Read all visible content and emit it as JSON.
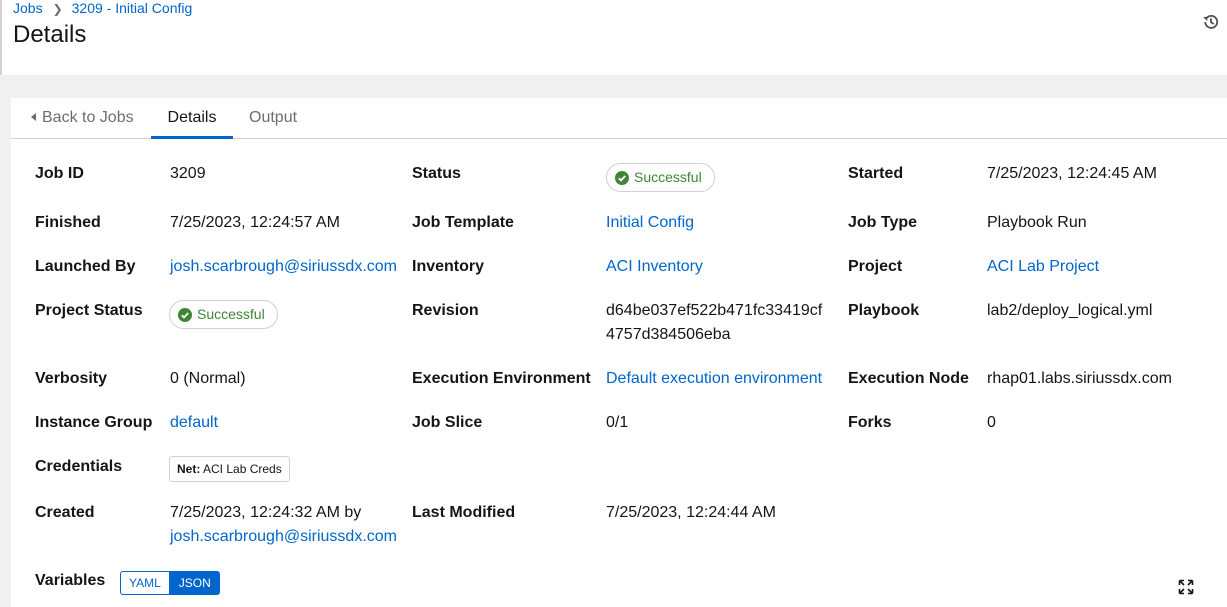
{
  "breadcrumb": {
    "jobs": "Jobs",
    "current": "3209 - Initial Config"
  },
  "page_title": "Details",
  "tabs": {
    "back": "Back to Jobs",
    "details": "Details",
    "output": "Output"
  },
  "fields": {
    "job_id": {
      "label": "Job ID",
      "value": "3209"
    },
    "status": {
      "label": "Status",
      "value": "Successful"
    },
    "started": {
      "label": "Started",
      "value": "7/25/2023, 12:24:45 AM"
    },
    "finished": {
      "label": "Finished",
      "value": "7/25/2023, 12:24:57 AM"
    },
    "job_template": {
      "label": "Job Template",
      "value": "Initial Config"
    },
    "job_type": {
      "label": "Job Type",
      "value": "Playbook Run"
    },
    "launched_by": {
      "label": "Launched By",
      "value": "josh.scarbrough@siriussdx.com"
    },
    "inventory": {
      "label": "Inventory",
      "value": "ACI Inventory"
    },
    "project": {
      "label": "Project",
      "value": "ACI Lab Project"
    },
    "project_status": {
      "label": "Project Status",
      "value": "Successful"
    },
    "revision": {
      "label": "Revision",
      "value_line1": "d64be037ef522b471fc33419cf",
      "value_line2": "4757d384506eba"
    },
    "playbook": {
      "label": "Playbook",
      "value": "lab2/deploy_logical.yml"
    },
    "verbosity": {
      "label": "Verbosity",
      "value": "0 (Normal)"
    },
    "execution_environment": {
      "label": "Execution Environment",
      "value": "Default execution environment"
    },
    "execution_node": {
      "label": "Execution Node",
      "value": "rhap01.labs.siriussdx.com"
    },
    "instance_group": {
      "label": "Instance Group",
      "value": "default"
    },
    "job_slice": {
      "label": "Job Slice",
      "value": "0/1"
    },
    "forks": {
      "label": "Forks",
      "value": "0"
    },
    "credentials": {
      "label": "Credentials",
      "chip_kind": "Net:",
      "chip_name": "ACI Lab Creds"
    },
    "created": {
      "label": "Created",
      "value": "7/25/2023, 12:24:32 AM by",
      "by": "josh.scarbrough@siriussdx.com"
    },
    "last_modified": {
      "label": "Last Modified",
      "value": "7/25/2023, 12:24:44 AM"
    },
    "variables": {
      "label": "Variables",
      "yaml": "YAML",
      "json": "JSON",
      "selected": "JSON"
    }
  },
  "colors": {
    "link": "#0066cc",
    "success": "#3e8635",
    "accent": "#0066cc"
  },
  "icons": {
    "history": "history-icon",
    "expand": "expand-icon",
    "success": "check-circle-icon",
    "back": "caret-left-icon"
  }
}
